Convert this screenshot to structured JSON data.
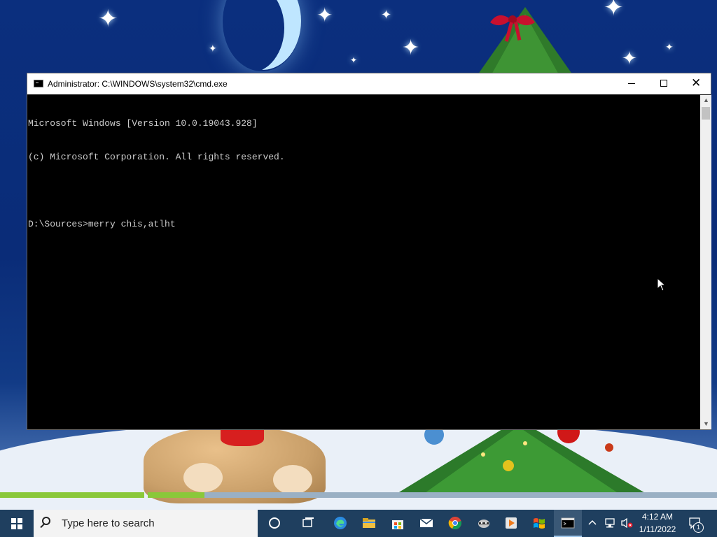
{
  "window": {
    "title": "Administrator: C:\\WINDOWS\\system32\\cmd.exe",
    "minimize_label": "",
    "maximize_label": "",
    "close_label": "✕"
  },
  "console": {
    "lines": [
      "Microsoft Windows [Version 10.0.19043.928]",
      "(c) Microsoft Corporation. All rights reserved.",
      "",
      "D:\\Sources>merry chis,atlht"
    ]
  },
  "desktop": {
    "progress_bars": [
      {
        "fill": 1.0
      },
      {
        "fill": 0.1
      }
    ]
  },
  "taskbar": {
    "search_placeholder": "Type here to search",
    "icons": [
      "cortana-icon",
      "task-view-icon",
      "edge-icon",
      "file-explorer-icon",
      "store-icon",
      "mail-icon",
      "chrome-icon",
      "raccoon-app-icon",
      "media-player-icon",
      "windows-flag-icon",
      "command-prompt-icon"
    ],
    "tray": {
      "time": "4:12 AM",
      "date": "1/11/2022",
      "notification_count": "1"
    }
  },
  "colors": {
    "console_bg": "#000000",
    "console_fg": "#cccccc",
    "taskbar_bg": "#1f3f5f",
    "progress_fill": "#8ac83a"
  }
}
